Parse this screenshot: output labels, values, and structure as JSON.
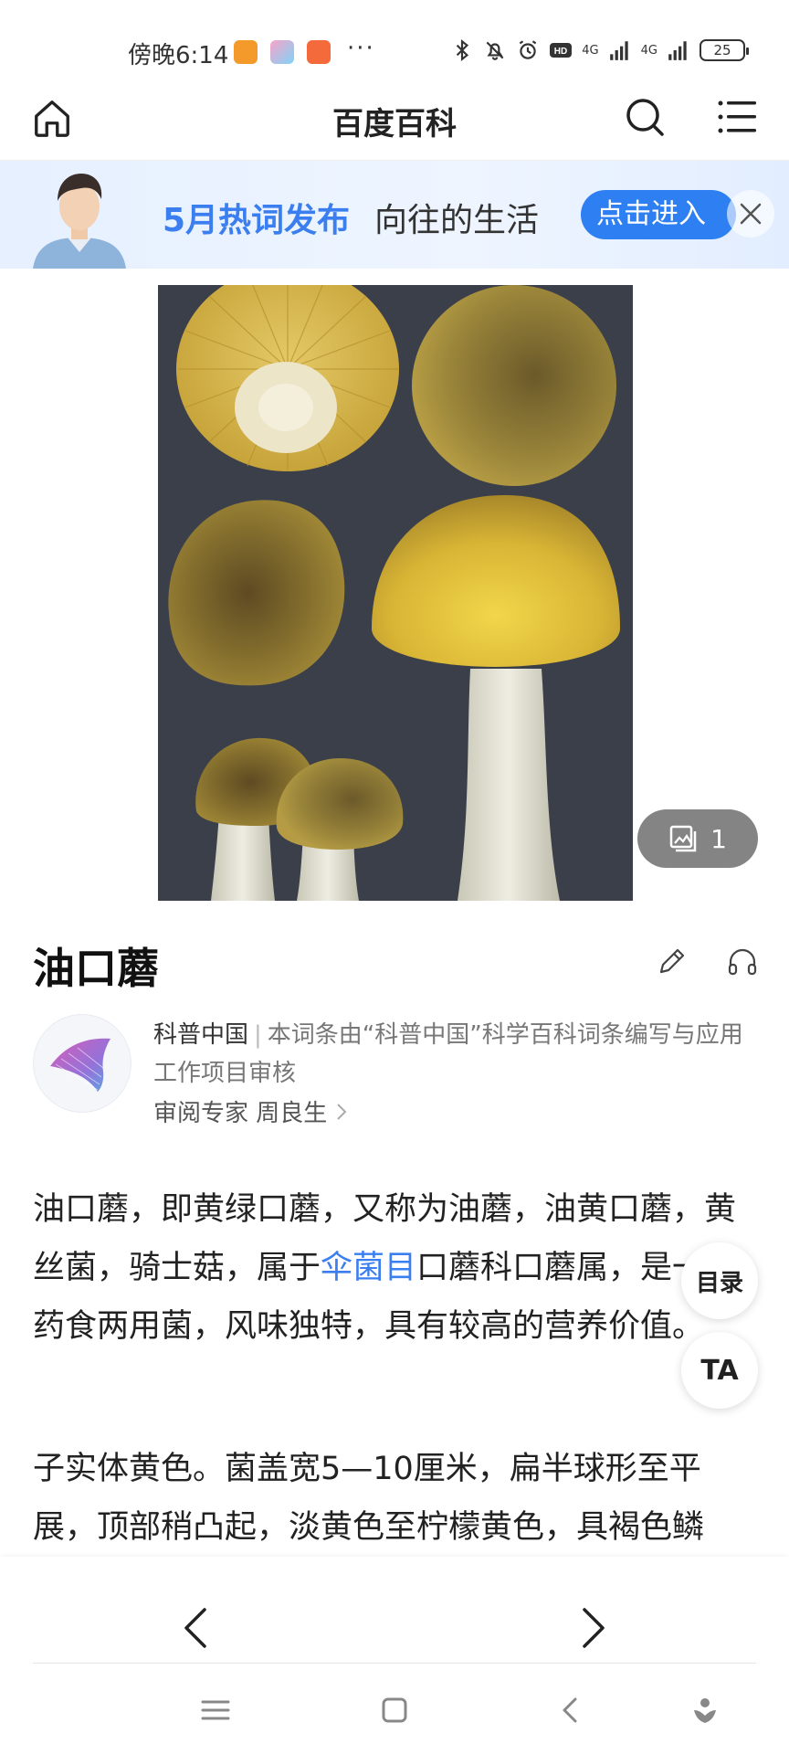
{
  "status_bar": {
    "time": "傍晚6:14",
    "more": "···",
    "network_1": "4G",
    "network_2": "4G",
    "battery": "25"
  },
  "header": {
    "title": "百度百科"
  },
  "banner": {
    "title": "5月热词发布",
    "subtitle": "向往的生活",
    "button_label": "点击进入"
  },
  "image": {
    "photo_count": "1"
  },
  "entry": {
    "title": "油口蘑"
  },
  "author": {
    "name": "科普中国",
    "separator": "|",
    "description": "本词条由“科普中国”科学百科词条编写与应用工作项目审核",
    "reviewer_label": "审阅专家 周良生"
  },
  "content": {
    "para1_before_link": "油口蘑，即黄绿口蘑，又称为油蘑，油黄口蘑，黄丝菌，骑士菇，属于",
    "para1_link": "伞菌目",
    "para1_after_link": "口蘑科口蘑属，是一种药食两用菌，风味独特，具有较高的营养价值。",
    "para2": "子实体黄色。菌盖宽5—10厘米，扁半球形至平展，顶部稍凸起，淡黄色至柠檬黄色，具褐色鳞"
  },
  "floating": {
    "toc_label": "目录",
    "font_label": "TA"
  },
  "colors": {
    "accent": "#3a7ef0",
    "banner_button": "#2e7ff2"
  }
}
